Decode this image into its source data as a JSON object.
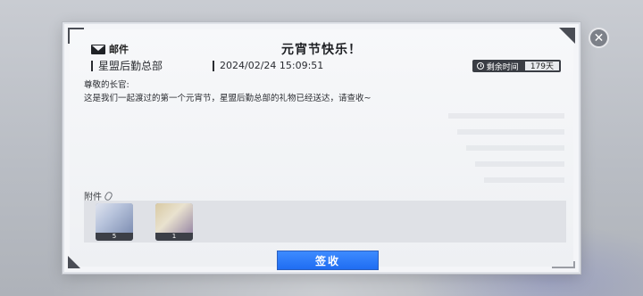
{
  "mail": {
    "header_label": "邮件",
    "title": "元宵节快乐！",
    "sender": "星盟后勤总部",
    "date": "2024/02/24 15:09:51",
    "remaining_label": "剩余时间",
    "remaining_value": "179天",
    "greeting": "尊敬的长官:",
    "body": "这是我们一起渡过的第一个元宵节，星盟后勤总部的礼物已经送达，请查收~"
  },
  "attachments": {
    "label": "附件",
    "items": [
      {
        "count": "5",
        "icon": "blue-ticket-icon"
      },
      {
        "count": "1",
        "icon": "document-bundle-icon"
      }
    ]
  },
  "actions": {
    "sign_label": "签收",
    "close_icon": "close-icon"
  }
}
